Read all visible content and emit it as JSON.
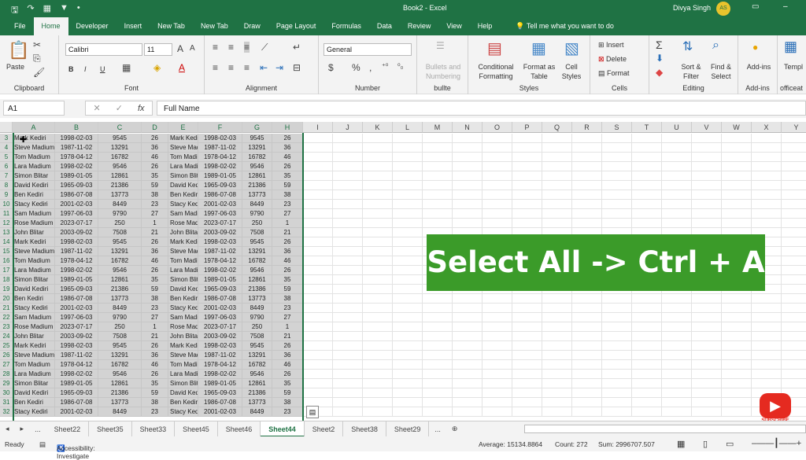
{
  "window": {
    "title": "Book2  -  Excel",
    "user": "Divya Singh",
    "avatar_initials": "AS",
    "accent": "#1f7244"
  },
  "tabs": [
    "File",
    "Home",
    "Developer",
    "Insert",
    "New Tab",
    "New Tab",
    "Draw",
    "Page Layout",
    "Formulas",
    "Data",
    "Review",
    "View",
    "Help"
  ],
  "active_tab": "Home",
  "tell_me": "Tell me what you want to do",
  "ribbon": {
    "clipboard": {
      "label": "Clipboard",
      "paste": "Paste"
    },
    "font": {
      "label": "Font",
      "name": "Calibri",
      "size": "11",
      "bold": "B",
      "italic": "I",
      "underline": "U"
    },
    "alignment": {
      "label": "Alignment"
    },
    "number": {
      "label": "Number",
      "format": "General",
      "currency": "$",
      "percent": "%",
      "comma": ","
    },
    "bullets": {
      "label": "bullte",
      "button": "Bullets and Numbering"
    },
    "styles": {
      "label": "Styles",
      "conditional": "Conditional Formatting",
      "format_table": "Format as Table",
      "cell_styles": "Cell Styles"
    },
    "cells": {
      "label": "Cells",
      "insert": "Insert",
      "delete": "Delete",
      "format": "Format"
    },
    "editing": {
      "label": "Editing",
      "sort": "Sort & Filter",
      "find": "Find & Select"
    },
    "addins": {
      "label": "Add-ins",
      "button": "Add-ins"
    },
    "officeat": {
      "label": "officeat",
      "button": "Templ"
    }
  },
  "formula_bar": {
    "name_box": "A1",
    "content": "Full Name",
    "fx": "fx"
  },
  "columns": [
    "A",
    "B",
    "C",
    "D",
    "E",
    "F",
    "G",
    "H",
    "I",
    "J",
    "K",
    "L",
    "M",
    "N",
    "O",
    "P",
    "Q",
    "R",
    "S",
    "T",
    "U",
    "V",
    "W",
    "X",
    "Y"
  ],
  "rows": [
    {
      "n": 3,
      "c": [
        "Mark Kediri",
        "1998-02-03",
        "9545",
        "26",
        "Mark Kediri",
        "1998-02-03",
        "9545",
        "26"
      ]
    },
    {
      "n": 4,
      "c": [
        "Steve Madium",
        "1987-11-02",
        "13291",
        "36",
        "Steve Madium",
        "1987-11-02",
        "13291",
        "36"
      ]
    },
    {
      "n": 5,
      "c": [
        "Tom Madium",
        "1978-04-12",
        "16782",
        "46",
        "Tom Madium",
        "1978-04-12",
        "16782",
        "46"
      ]
    },
    {
      "n": 6,
      "c": [
        "Lara Madium",
        "1998-02-02",
        "9546",
        "26",
        "Lara Madium",
        "1998-02-02",
        "9546",
        "26"
      ]
    },
    {
      "n": 7,
      "c": [
        "Simon Blitar",
        "1989-01-05",
        "12861",
        "35",
        "Simon Blitar",
        "1989-01-05",
        "12861",
        "35"
      ]
    },
    {
      "n": 8,
      "c": [
        "David Kediri",
        "1965-09-03",
        "21386",
        "59",
        "David Kediri",
        "1965-09-03",
        "21386",
        "59"
      ]
    },
    {
      "n": 9,
      "c": [
        "Ben Kediri",
        "1986-07-08",
        "13773",
        "38",
        "Ben Kediri",
        "1986-07-08",
        "13773",
        "38"
      ]
    },
    {
      "n": 10,
      "c": [
        "Stacy Kediri",
        "2001-02-03",
        "8449",
        "23",
        "Stacy Kediri",
        "2001-02-03",
        "8449",
        "23"
      ]
    },
    {
      "n": 11,
      "c": [
        "Sam Madium",
        "1997-06-03",
        "9790",
        "27",
        "Sam Madium",
        "1997-06-03",
        "9790",
        "27"
      ]
    },
    {
      "n": 12,
      "c": [
        "Rose Madium",
        "2023-07-17",
        "250",
        "1",
        "Rose Madium",
        "2023-07-17",
        "250",
        "1"
      ]
    },
    {
      "n": 13,
      "c": [
        "John Blitar",
        "2003-09-02",
        "7508",
        "21",
        "John Blitar",
        "2003-09-02",
        "7508",
        "21"
      ]
    },
    {
      "n": 14,
      "c": [
        "Mark Kediri",
        "1998-02-03",
        "9545",
        "26",
        "Mark Kediri",
        "1998-02-03",
        "9545",
        "26"
      ]
    },
    {
      "n": 15,
      "c": [
        "Steve Madium",
        "1987-11-02",
        "13291",
        "36",
        "Steve Madium",
        "1987-11-02",
        "13291",
        "36"
      ]
    },
    {
      "n": 16,
      "c": [
        "Tom Madium",
        "1978-04-12",
        "16782",
        "46",
        "Tom Madium",
        "1978-04-12",
        "16782",
        "46"
      ]
    },
    {
      "n": 17,
      "c": [
        "Lara Madium",
        "1998-02-02",
        "9546",
        "26",
        "Lara Madium",
        "1998-02-02",
        "9546",
        "26"
      ]
    },
    {
      "n": 18,
      "c": [
        "Simon Blitar",
        "1989-01-05",
        "12861",
        "35",
        "Simon Blitar",
        "1989-01-05",
        "12861",
        "35"
      ]
    },
    {
      "n": 19,
      "c": [
        "David Kediri",
        "1965-09-03",
        "21386",
        "59",
        "David Kediri",
        "1965-09-03",
        "21386",
        "59"
      ]
    },
    {
      "n": 20,
      "c": [
        "Ben Kediri",
        "1986-07-08",
        "13773",
        "38",
        "Ben Kediri",
        "1986-07-08",
        "13773",
        "38"
      ]
    },
    {
      "n": 21,
      "c": [
        "Stacy Kediri",
        "2001-02-03",
        "8449",
        "23",
        "Stacy Kediri",
        "2001-02-03",
        "8449",
        "23"
      ]
    },
    {
      "n": 22,
      "c": [
        "Sam Madium",
        "1997-06-03",
        "9790",
        "27",
        "Sam Madium",
        "1997-06-03",
        "9790",
        "27"
      ]
    },
    {
      "n": 23,
      "c": [
        "Rose Madium",
        "2023-07-17",
        "250",
        "1",
        "Rose Madium",
        "2023-07-17",
        "250",
        "1"
      ]
    },
    {
      "n": 24,
      "c": [
        "John Blitar",
        "2003-09-02",
        "7508",
        "21",
        "John Blitar",
        "2003-09-02",
        "7508",
        "21"
      ]
    },
    {
      "n": 25,
      "c": [
        "Mark Kediri",
        "1998-02-03",
        "9545",
        "26",
        "Mark Kediri",
        "1998-02-03",
        "9545",
        "26"
      ]
    },
    {
      "n": 26,
      "c": [
        "Steve Madium",
        "1987-11-02",
        "13291",
        "36",
        "Steve Madium",
        "1987-11-02",
        "13291",
        "36"
      ]
    },
    {
      "n": 27,
      "c": [
        "Tom Madium",
        "1978-04-12",
        "16782",
        "46",
        "Tom Madium",
        "1978-04-12",
        "16782",
        "46"
      ]
    },
    {
      "n": 28,
      "c": [
        "Lara Madium",
        "1998-02-02",
        "9546",
        "26",
        "Lara Madium",
        "1998-02-02",
        "9546",
        "26"
      ]
    },
    {
      "n": 29,
      "c": [
        "Simon Blitar",
        "1989-01-05",
        "12861",
        "35",
        "Simon Blitar",
        "1989-01-05",
        "12861",
        "35"
      ]
    },
    {
      "n": 30,
      "c": [
        "David Kediri",
        "1965-09-03",
        "21386",
        "59",
        "David Kediri",
        "1965-09-03",
        "21386",
        "59"
      ]
    },
    {
      "n": 31,
      "c": [
        "Ben Kediri",
        "1986-07-08",
        "13773",
        "38",
        "Ben Kediri",
        "1986-07-08",
        "13773",
        "38"
      ]
    },
    {
      "n": 32,
      "c": [
        "Stacy Kediri",
        "2001-02-03",
        "8449",
        "23",
        "Stacy Kediri",
        "2001-02-03",
        "8449",
        "23"
      ]
    }
  ],
  "overlay": {
    "text": "Select All -> Ctrl + A",
    "color": "#3b9b29"
  },
  "subscribe": "SUBSCRIBE",
  "sheets": [
    "Sheet22",
    "Sheet35",
    "Sheet33",
    "Sheet45",
    "Sheet46",
    "Sheet44",
    "Sheet2",
    "Sheet38",
    "Sheet29"
  ],
  "active_sheet": "Sheet44",
  "status": {
    "ready": "Ready",
    "accessibility": "Accessibility: Investigate",
    "average": "Average: 15134.8864",
    "count": "Count: 272",
    "sum": "Sum: 2996707.507"
  }
}
